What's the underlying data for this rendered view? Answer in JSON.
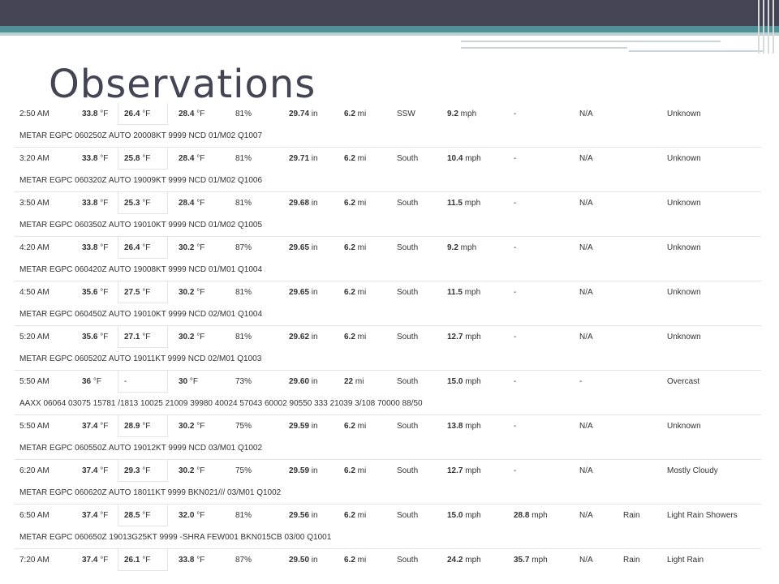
{
  "slide": {
    "title": "Observations"
  },
  "observations": [
    {
      "time": "2:50 AM",
      "temp": "33.8",
      "heat_index": "26.4",
      "dew_point": "28.4",
      "humidity": "81%",
      "pressure": "29.74",
      "visibility": "6.2",
      "wind_dir": "SSW",
      "wind_speed": "9.2",
      "gust": "-",
      "precip": "N/A",
      "events": "",
      "conditions": "Unknown",
      "metar": "METAR EGPC 060250Z AUTO 20008KT 9999 NCD 01/M02 Q1007"
    },
    {
      "time": "3:20 AM",
      "temp": "33.8",
      "heat_index": "25.8",
      "dew_point": "28.4",
      "humidity": "81%",
      "pressure": "29.71",
      "visibility": "6.2",
      "wind_dir": "South",
      "wind_speed": "10.4",
      "gust": "-",
      "precip": "N/A",
      "events": "",
      "conditions": "Unknown",
      "metar": "METAR EGPC 060320Z AUTO 19009KT 9999 NCD 01/M02 Q1006"
    },
    {
      "time": "3:50 AM",
      "temp": "33.8",
      "heat_index": "25.3",
      "dew_point": "28.4",
      "humidity": "81%",
      "pressure": "29.68",
      "visibility": "6.2",
      "wind_dir": "South",
      "wind_speed": "11.5",
      "gust": "-",
      "precip": "N/A",
      "events": "",
      "conditions": "Unknown",
      "metar": "METAR EGPC 060350Z AUTO 19010KT 9999 NCD 01/M02 Q1005"
    },
    {
      "time": "4:20 AM",
      "temp": "33.8",
      "heat_index": "26.4",
      "dew_point": "30.2",
      "humidity": "87%",
      "pressure": "29.65",
      "visibility": "6.2",
      "wind_dir": "South",
      "wind_speed": "9.2",
      "gust": "-",
      "precip": "N/A",
      "events": "",
      "conditions": "Unknown",
      "metar": "METAR EGPC 060420Z AUTO 19008KT 9999 NCD 01/M01 Q1004"
    },
    {
      "time": "4:50 AM",
      "temp": "35.6",
      "heat_index": "27.5",
      "dew_point": "30.2",
      "humidity": "81%",
      "pressure": "29.65",
      "visibility": "6.2",
      "wind_dir": "South",
      "wind_speed": "11.5",
      "gust": "-",
      "precip": "N/A",
      "events": "",
      "conditions": "Unknown",
      "metar": "METAR EGPC 060450Z AUTO 19010KT 9999 NCD 02/M01 Q1004"
    },
    {
      "time": "5:20 AM",
      "temp": "35.6",
      "heat_index": "27.1",
      "dew_point": "30.2",
      "humidity": "81%",
      "pressure": "29.62",
      "visibility": "6.2",
      "wind_dir": "South",
      "wind_speed": "12.7",
      "gust": "-",
      "precip": "N/A",
      "events": "",
      "conditions": "Unknown",
      "metar": "METAR EGPC 060520Z AUTO 19011KT 9999 NCD 02/M01 Q1003"
    },
    {
      "time": "5:50 AM",
      "temp": "36",
      "heat_index": "-",
      "dew_point": "30",
      "humidity": "73%",
      "pressure": "29.60",
      "visibility": "22",
      "wind_dir": "South",
      "wind_speed": "15.0",
      "gust": "-",
      "precip": "-",
      "events": "",
      "conditions": "Overcast",
      "metar": "AAXX 06064 03075 15781 /1813 10025 21009 39980 40024 57043 60002 90550 333 21039 3/108 70000 88/50"
    },
    {
      "time": "5:50 AM",
      "temp": "37.4",
      "heat_index": "28.9",
      "dew_point": "30.2",
      "humidity": "75%",
      "pressure": "29.59",
      "visibility": "6.2",
      "wind_dir": "South",
      "wind_speed": "13.8",
      "gust": "-",
      "precip": "N/A",
      "events": "",
      "conditions": "Unknown",
      "metar": "METAR EGPC 060550Z AUTO 19012KT 9999 NCD 03/M01 Q1002"
    },
    {
      "time": "6:20 AM",
      "temp": "37.4",
      "heat_index": "29.3",
      "dew_point": "30.2",
      "humidity": "75%",
      "pressure": "29.59",
      "visibility": "6.2",
      "wind_dir": "South",
      "wind_speed": "12.7",
      "gust": "-",
      "precip": "N/A",
      "events": "",
      "conditions": "Mostly Cloudy",
      "metar": "METAR EGPC 060620Z AUTO 18011KT 9999 BKN021/// 03/M01 Q1002"
    },
    {
      "time": "6:50 AM",
      "temp": "37.4",
      "heat_index": "28.5",
      "dew_point": "32.0",
      "humidity": "81%",
      "pressure": "29.56",
      "visibility": "6.2",
      "wind_dir": "South",
      "wind_speed": "15.0",
      "gust": "28.8",
      "precip": "N/A",
      "events": "Rain",
      "conditions": "Light Rain Showers",
      "metar": "METAR EGPC 060650Z 19013G25KT 9999 -SHRA FEW001 BKN015CB 03/00 Q1001"
    },
    {
      "time": "7:20 AM",
      "temp": "37.4",
      "heat_index": "26.1",
      "dew_point": "33.8",
      "humidity": "87%",
      "pressure": "29.50",
      "visibility": "6.2",
      "wind_dir": "South",
      "wind_speed": "24.2",
      "gust": "35.7",
      "precip": "N/A",
      "events": "Rain",
      "conditions": "Light Rain",
      "metar": ""
    }
  ],
  "units": {
    "temp": "°F",
    "pressure": "in",
    "visibility": "mi",
    "speed": "mph"
  },
  "colors": {
    "topbar": "#434554",
    "teal": "#4f8f95",
    "title": "#434554"
  }
}
